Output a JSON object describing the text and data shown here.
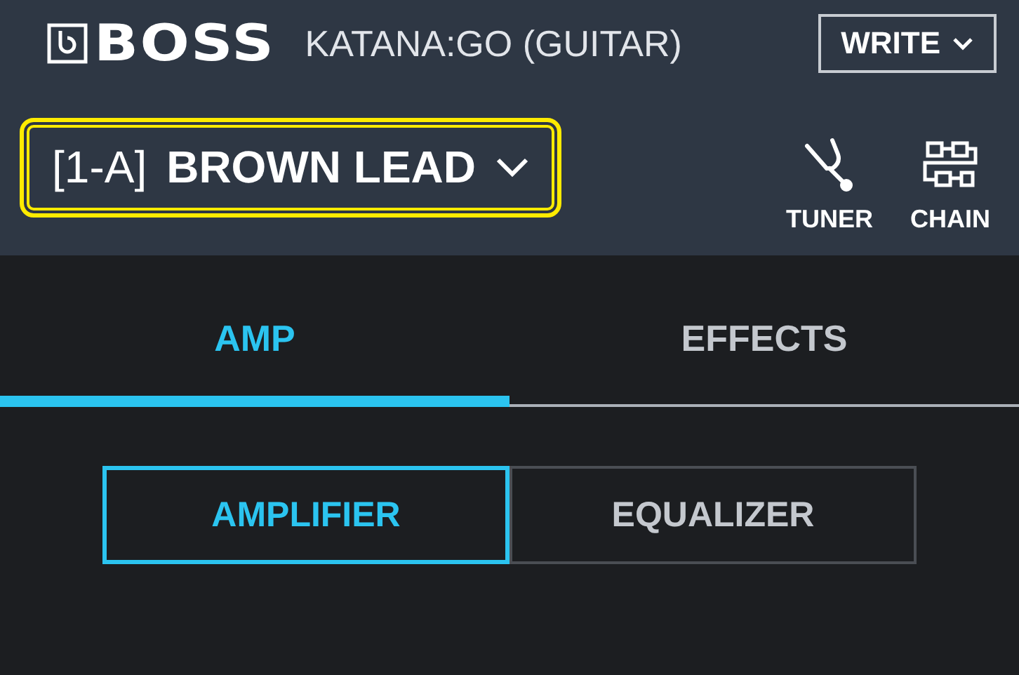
{
  "header": {
    "logo": "BOSS",
    "device": "KATANA:GO (GUITAR)",
    "write_button": "WRITE"
  },
  "preset": {
    "number": "[1-A]",
    "name": "BROWN LEAD",
    "highlighted": true
  },
  "tools": [
    {
      "kind": "tuner",
      "label": "TUNER"
    },
    {
      "kind": "chain",
      "label": "CHAIN"
    }
  ],
  "tabs": [
    {
      "label": "AMP",
      "selected": true
    },
    {
      "label": "EFFECTS",
      "selected": false
    }
  ],
  "subtabs": [
    {
      "label": "AMPLIFIER",
      "selected": true
    },
    {
      "label": "EQUALIZER",
      "selected": false
    }
  ]
}
